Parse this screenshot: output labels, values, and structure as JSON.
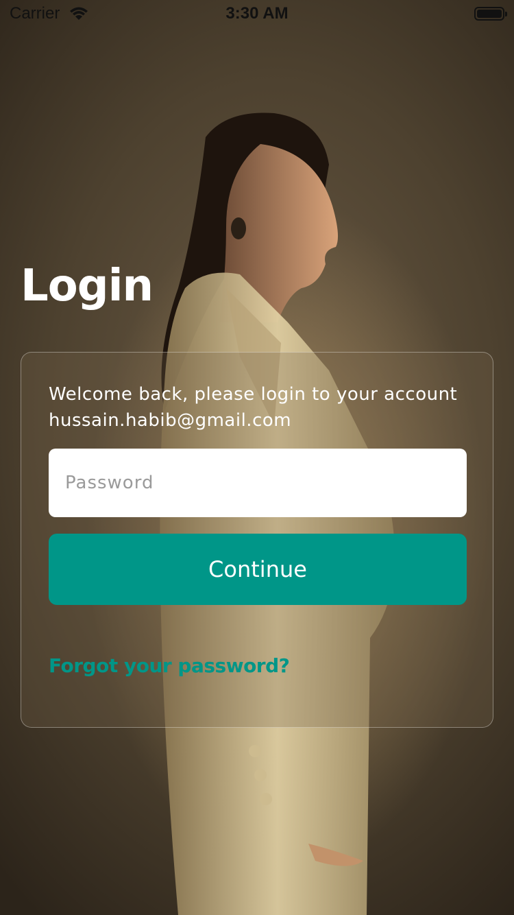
{
  "status_bar": {
    "carrier": "Carrier",
    "time": "3:30 AM"
  },
  "header": {
    "title": "Login"
  },
  "card": {
    "welcome_text": "Welcome back, please login to your account",
    "email": "hussain.habib@gmail.com",
    "password_placeholder": "Password",
    "continue_label": "Continue",
    "forgot_label": "Forgot your password?"
  },
  "colors": {
    "accent": "#009688",
    "background": "#4d412f"
  },
  "icons": [
    "wifi-icon",
    "battery-icon"
  ]
}
